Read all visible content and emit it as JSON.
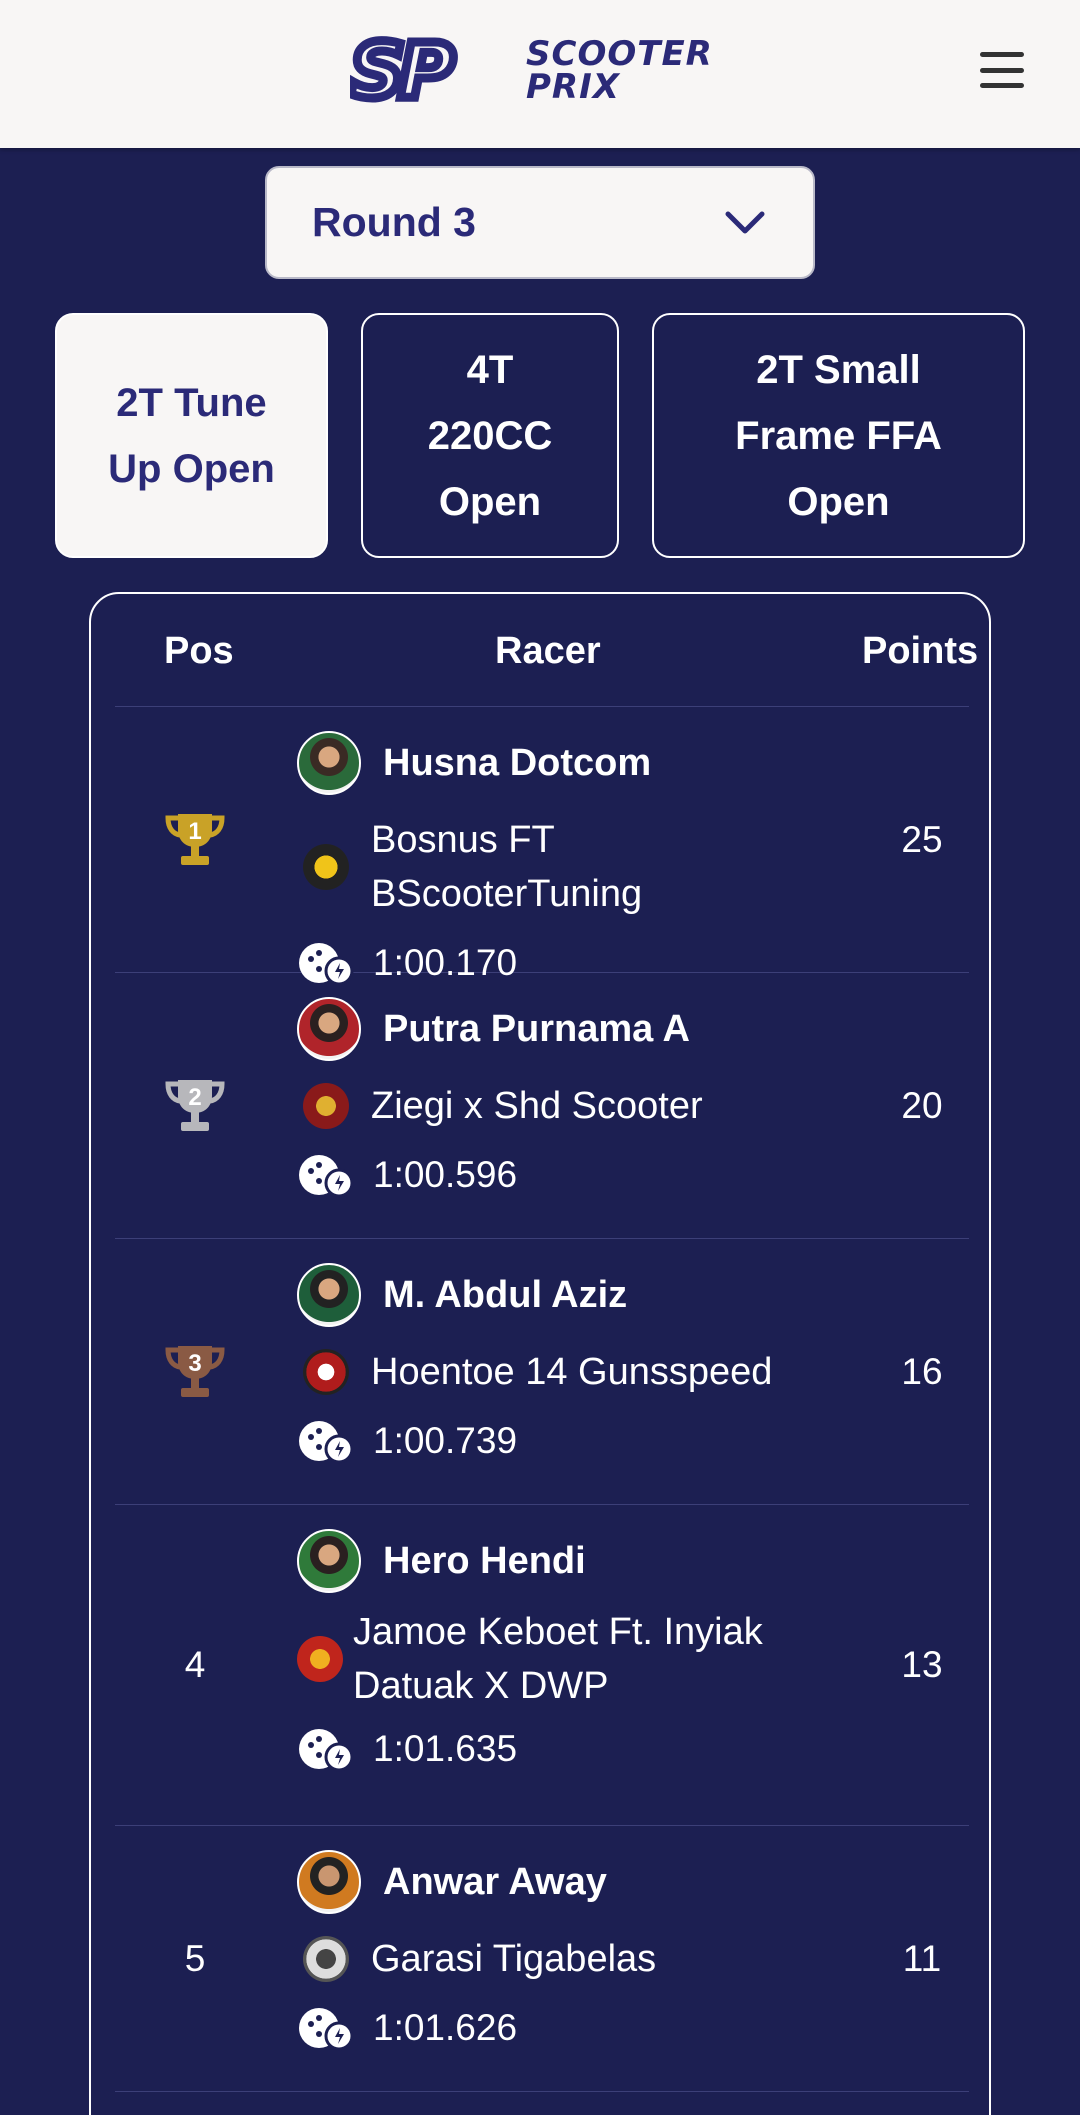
{
  "header": {
    "logo_mark": "SP",
    "logo_line1": "SCOOTER",
    "logo_line2": "PRIX",
    "menu_icon": "hamburger-menu-icon"
  },
  "round_select": {
    "value": "Round 3",
    "icon": "chevron-down-icon"
  },
  "tabs": [
    {
      "lines": [
        "2T Tune",
        "Up Open"
      ],
      "active": true
    },
    {
      "lines": [
        "4T",
        "220CC",
        "Open"
      ],
      "active": false
    },
    {
      "lines": [
        "2T Small",
        "Frame FFA",
        "Open"
      ],
      "active": false
    }
  ],
  "table": {
    "headers": {
      "pos": "Pos",
      "racer": "Racer",
      "points": "Points"
    },
    "rows": [
      {
        "pos": "1",
        "trophy": "gold",
        "name": "Husna Dotcom",
        "team": "Bosnus FT BScooterTuning",
        "time": "1:00.170",
        "points": "25"
      },
      {
        "pos": "2",
        "trophy": "silver",
        "name": "Putra Purnama A",
        "team": "Ziegi x Shd Scooter",
        "time": "1:00.596",
        "points": "20"
      },
      {
        "pos": "3",
        "trophy": "bronze",
        "name": "M. Abdul Aziz",
        "team": "Hoentoe 14 Gunsspeed",
        "time": "1:00.739",
        "points": "16"
      },
      {
        "pos": "4",
        "trophy": "",
        "name": "Hero Hendi",
        "team": "Jamoe Keboet Ft. Inyiak Datuak X DWP",
        "time": "1:01.635",
        "points": "13"
      },
      {
        "pos": "5",
        "trophy": "",
        "name": "Anwar Away",
        "team": "Garasi Tigabelas",
        "time": "1:01.626",
        "points": "11"
      }
    ]
  },
  "colors": {
    "background": "#1c1f52",
    "header_bg": "#f8f6f5",
    "brand": "#2b2a78",
    "gold": "#c9a227",
    "silver": "#b7b7bb",
    "bronze": "#8a5a44"
  }
}
